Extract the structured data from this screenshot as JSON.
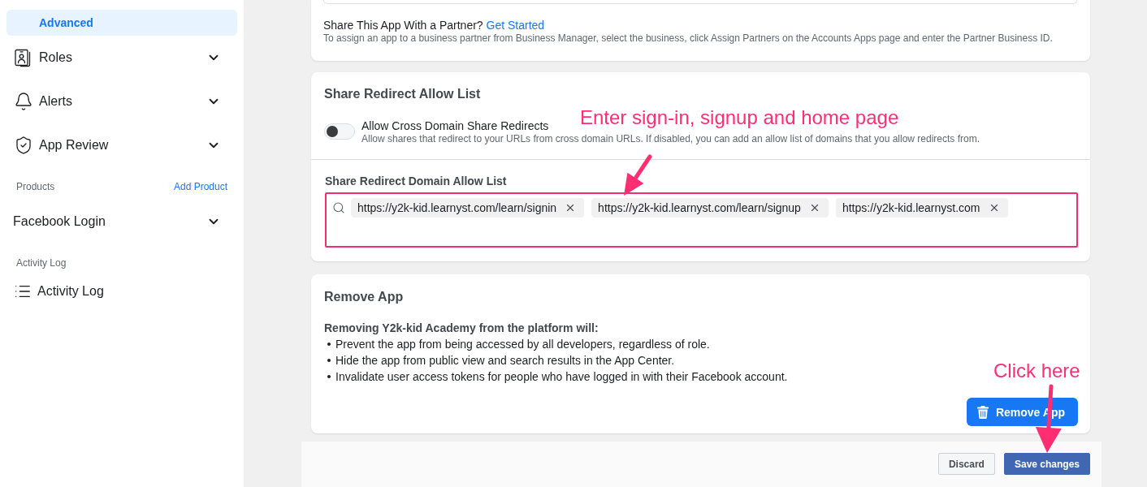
{
  "sidebar": {
    "top_items": [
      {
        "kind": "subitem",
        "label": "Advanced",
        "selected": true
      },
      {
        "kind": "group",
        "label": "Roles",
        "selected": false,
        "expanded": false
      },
      {
        "kind": "group",
        "label": "Alerts",
        "selected": false,
        "expanded": false
      },
      {
        "kind": "group",
        "label": "App Review",
        "selected": false,
        "expanded": false
      }
    ],
    "sections": [
      {
        "title": "Products",
        "action": "Add Product",
        "items": [
          {
            "kind": "group",
            "label": "Facebook Login",
            "selected": false,
            "expanded": false
          }
        ]
      },
      {
        "title": "Activity Log",
        "items": [
          {
            "kind": "link",
            "label": "Activity Log",
            "selected": false
          }
        ]
      }
    ]
  },
  "partner_card": {
    "question": "Share This App With a Partner?",
    "link": "Get Started",
    "description": "To assign an app to a business partner from Business Manager, select the business, click Assign Partners on the Accounts Apps page and enter the Partner Business ID."
  },
  "redirect_card": {
    "title": "Share Redirect Allow List",
    "toggle": {
      "label": "Allow Cross Domain Share Redirects",
      "description": "Allow shares that redirect to your URLs from cross domain URLs. If disabled, you can add an allow list of domains that you allow redirects from.",
      "on": false
    },
    "domain_list": {
      "label": "Share Redirect Domain Allow List",
      "highlighted": true,
      "tags": [
        "https://y2k-kid.learnyst.com/learn/signin",
        "https://y2k-kid.learnyst.com/learn/signup",
        "https://y2k-kid.learnyst.com"
      ]
    }
  },
  "remove_card": {
    "title": "Remove App",
    "intro": "Removing Y2k-kid Academy from the platform will:",
    "bullets": [
      "Prevent the app from being accessed by all developers, regardless of role.",
      "Hide the app from public view and search results in the App Center.",
      "Invalidate user access tokens for people who have logged in with their Facebook account."
    ],
    "button": "Remove App"
  },
  "footer": {
    "buttons": [
      {
        "kind": "secondary",
        "label": "Discard"
      },
      {
        "kind": "primary",
        "label": "Save changes"
      }
    ]
  },
  "annotations": [
    {
      "text": "Enter sign-in, signup and home page"
    },
    {
      "text": "Click here"
    }
  ]
}
